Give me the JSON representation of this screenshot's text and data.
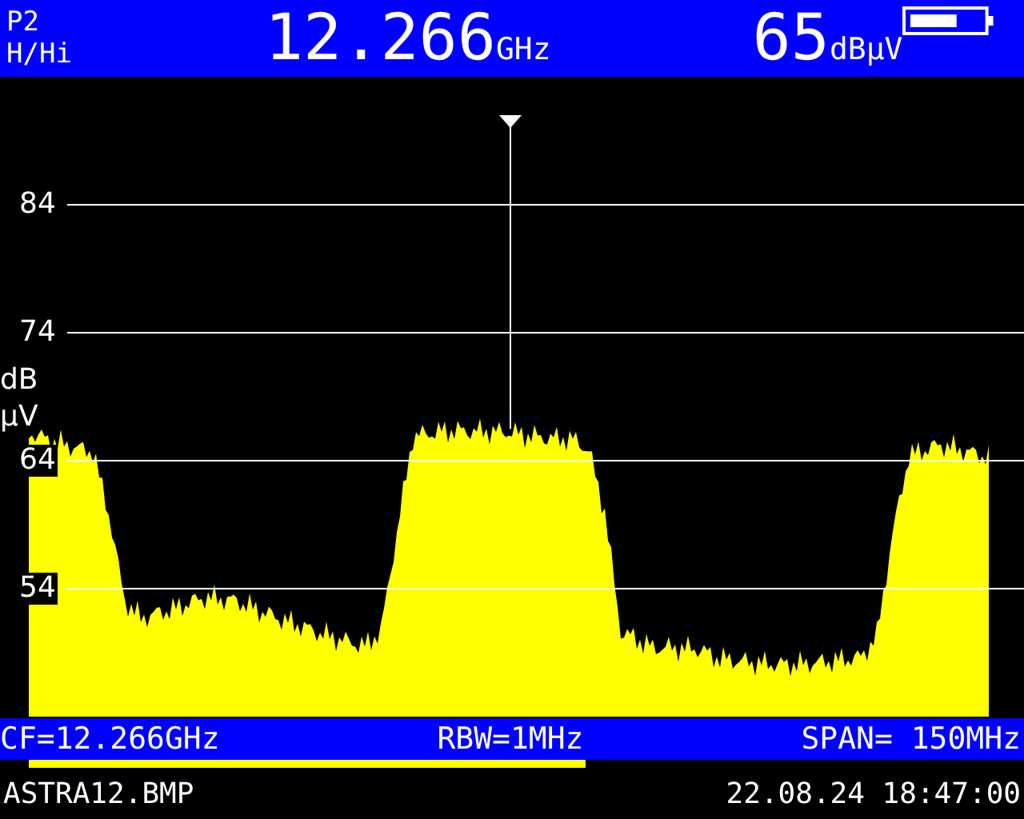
{
  "header": {
    "preset": "P2",
    "band": "H/Hi",
    "frequency": "12.266",
    "frequency_unit": "GHz",
    "level": "65",
    "level_unit": "dBµV"
  },
  "spectrum": {
    "y_ticks": [
      "84",
      "74",
      "64",
      "54"
    ],
    "y_axis_label": [
      "dB",
      "µV"
    ]
  },
  "settings_bar": {
    "center_frequency": "CF=12.266GHz",
    "rbw": "RBW=1MHz",
    "span": "SPAN= 150MHz"
  },
  "position_bar": {
    "level": 0.59
  },
  "status": {
    "file": "ASTRA12.BMP",
    "datetime": "22.08.24 18:47:00"
  }
}
